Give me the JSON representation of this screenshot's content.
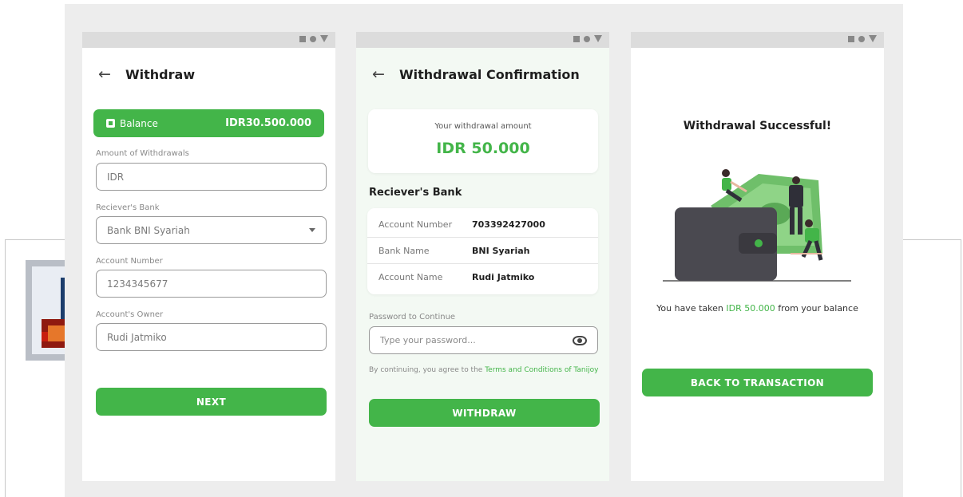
{
  "colors": {
    "accent": "#43b549",
    "panel_bg": "#ededed",
    "status_bar": "#dcdcdc"
  },
  "statusbar_icons": [
    "square-icon",
    "circle-icon",
    "triangle-down-icon"
  ],
  "withdraw": {
    "title": "Withdraw",
    "balance_label": "Balance",
    "balance_value": "IDR30.500.000",
    "amount_label": "Amount of Withdrawals",
    "amount_placeholder": "IDR",
    "bank_label": "Reciever's Bank",
    "bank_value": "Bank BNI Syariah",
    "account_number_label": "Account Number",
    "account_number_value": "1234345677",
    "owner_label": "Account's Owner",
    "owner_value": "Rudi Jatmiko",
    "next_button": "NEXT"
  },
  "confirmation": {
    "title": "Withdrawal Confirmation",
    "amount_caption": "Your withdrawal amount",
    "amount_value": "IDR 50.000",
    "section_title": "Reciever's Bank",
    "rows": [
      {
        "label": "Account Number",
        "value": "703392427000"
      },
      {
        "label": "Bank Name",
        "value": "BNI Syariah"
      },
      {
        "label": "Account Name",
        "value": "Rudi Jatmiko"
      }
    ],
    "password_label": "Password to Continue",
    "password_placeholder": "Type your password...",
    "terms_prefix": "By continuing, you agree to the ",
    "terms_link": "Terms and Conditions of Tanijoy",
    "withdraw_button": "WITHDRAW"
  },
  "success": {
    "title": "Withdrawal Successful!",
    "msg_prefix": "You have taken ",
    "msg_amount": "IDR 50.000",
    "msg_suffix": " from your balance",
    "back_button": "BACK TO TRANSACTION"
  }
}
